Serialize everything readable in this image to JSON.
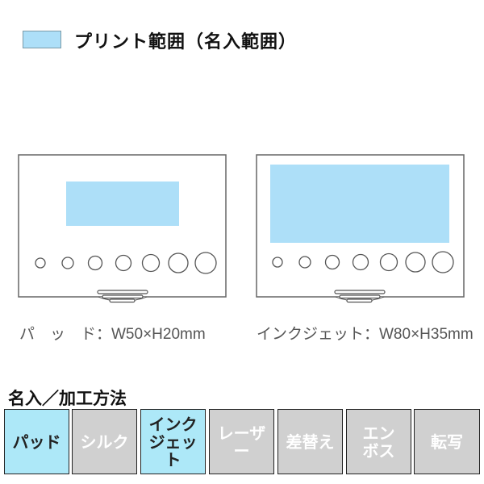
{
  "legend": {
    "label": "プリント範囲（名入範囲）",
    "swatch_color": "#addff8"
  },
  "devices": [
    {
      "name": "pad",
      "label": "パ　ッ　ド：W50×H20mm"
    },
    {
      "name": "inkjet",
      "label": "インクジェット：W80×H35mm"
    }
  ],
  "methods": {
    "title": "名入／加工方法",
    "items": [
      {
        "line1": "パッド",
        "line2": "",
        "active": true
      },
      {
        "line1": "シルク",
        "line2": "",
        "active": false
      },
      {
        "line1": "インク",
        "line2": "ジェット",
        "active": true
      },
      {
        "line1": "レーザー",
        "line2": "",
        "active": false
      },
      {
        "line1": "差替え",
        "line2": "",
        "active": false
      },
      {
        "line1": "エン",
        "line2": "ボス",
        "active": false
      },
      {
        "line1": "転写",
        "line2": "",
        "active": false
      }
    ]
  },
  "colors": {
    "active": "#ade8f8",
    "inactive": "#d0d0d0",
    "print_area": "#addff8",
    "outline": "#666666"
  }
}
